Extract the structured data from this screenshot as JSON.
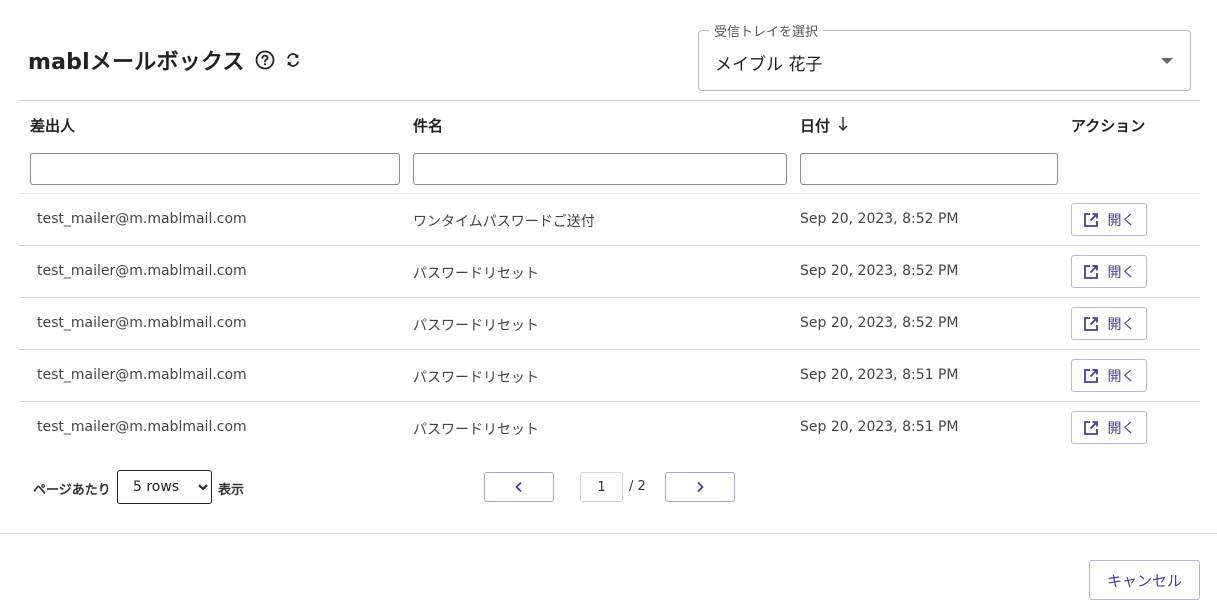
{
  "header": {
    "title": "mablメールボックス",
    "help_icon": "help-circle-icon",
    "refresh_icon": "refresh-icon"
  },
  "inbox": {
    "legend": "受信トレイを選択",
    "selected": "メイブル 花子"
  },
  "table": {
    "columns": {
      "from": "差出人",
      "subject": "件名",
      "date": "日付",
      "actions": "アクション"
    },
    "sort_icon": "arrow-down-icon",
    "open_label": "開く",
    "rows": [
      {
        "from": "test_mailer@m.mablmail.com",
        "subject": "ワンタイムパスワードご送付",
        "date": "Sep 20, 2023, 8:52 PM"
      },
      {
        "from": "test_mailer@m.mablmail.com",
        "subject": "パスワードリセット",
        "date": "Sep 20, 2023, 8:52 PM"
      },
      {
        "from": "test_mailer@m.mablmail.com",
        "subject": "パスワードリセット",
        "date": "Sep 20, 2023, 8:52 PM"
      },
      {
        "from": "test_mailer@m.mablmail.com",
        "subject": "パスワードリセット",
        "date": "Sep 20, 2023, 8:51 PM"
      },
      {
        "from": "test_mailer@m.mablmail.com",
        "subject": "パスワードリセット",
        "date": "Sep 20, 2023, 8:51 PM"
      }
    ]
  },
  "pagination": {
    "per_page_label": "ページあたり",
    "rows_option": "5 rows",
    "show_label": "表示",
    "current_page": "1",
    "total": "/ 2"
  },
  "footer": {
    "cancel_label": "キャンセル"
  },
  "colors": {
    "accent": "#4a3aa8"
  }
}
